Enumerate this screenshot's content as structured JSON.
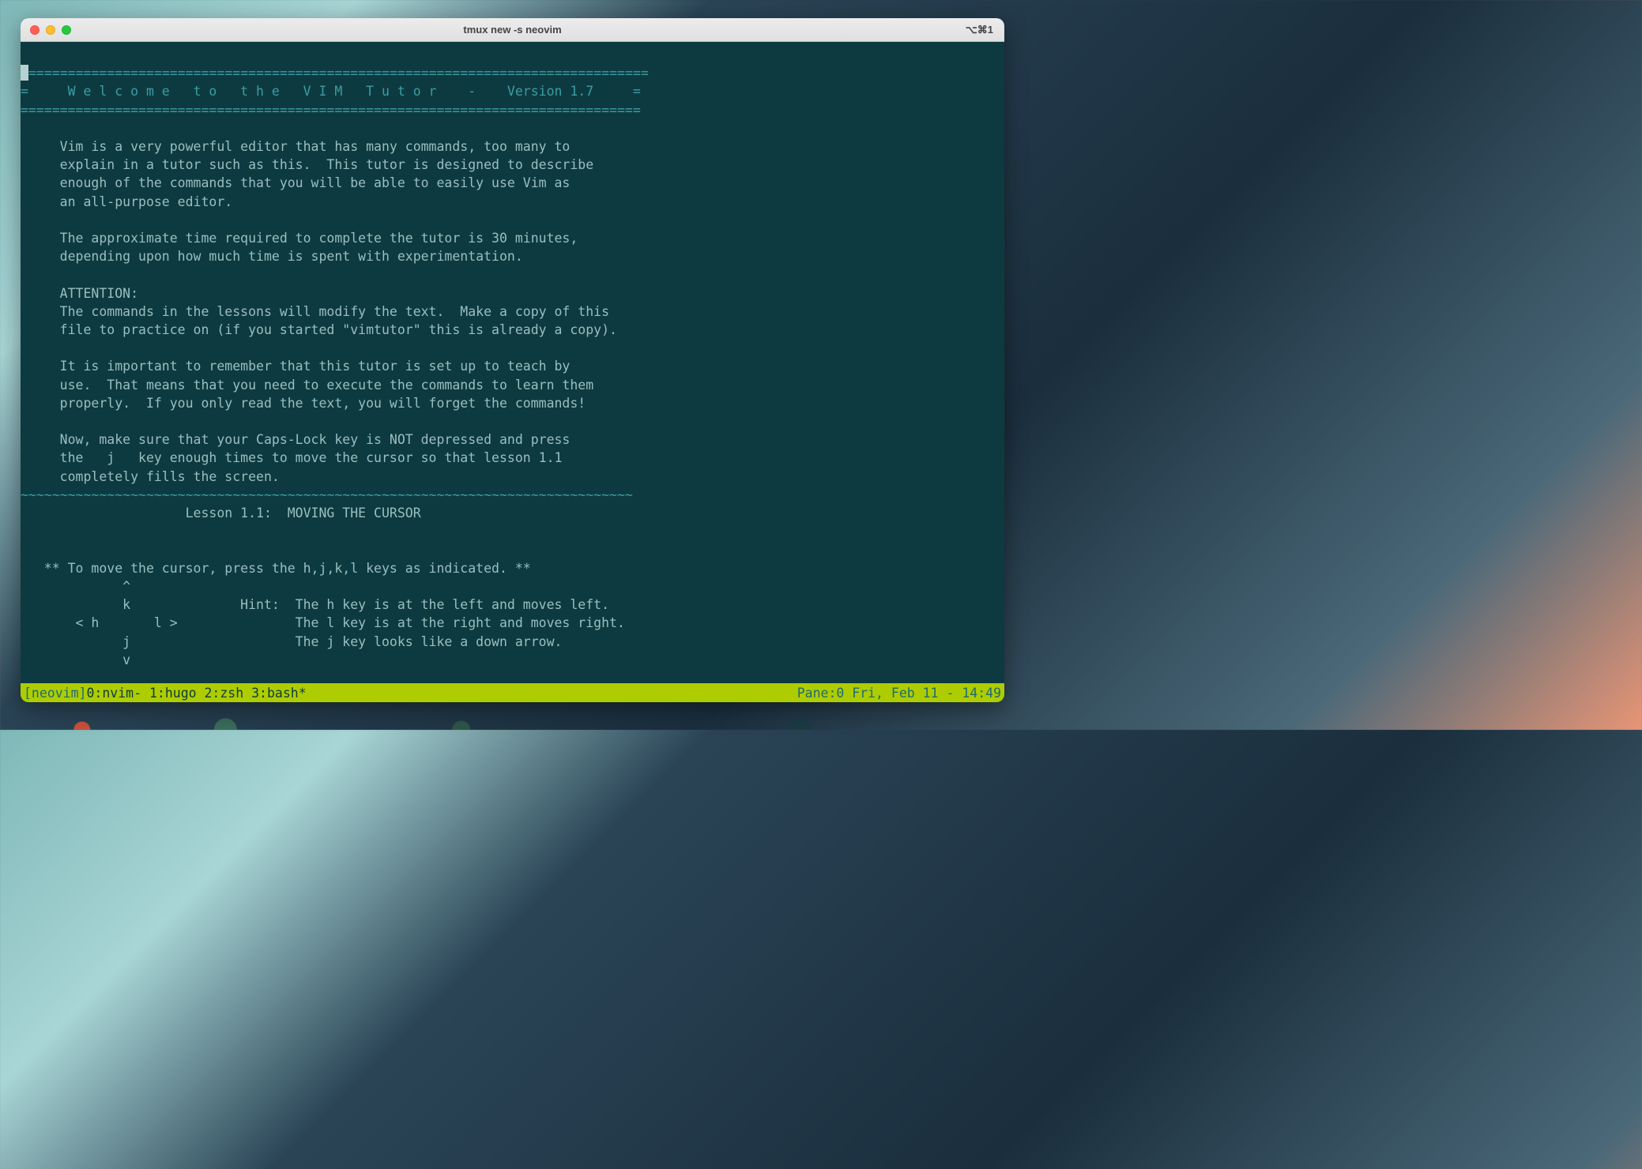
{
  "titlebar": {
    "title": "tmux new -s neovim",
    "shortcut": "⌥⌘1"
  },
  "term": {
    "eq_line": "===============================================================================",
    "header_line": "=     W e l c o m e   t o   t h e   V I M   T u t o r    -    Version 1.7     =",
    "p1_l1": "     Vim is a very powerful editor that has many commands, too many to",
    "p1_l2": "     explain in a tutor such as this.  This tutor is designed to describe",
    "p1_l3": "     enough of the commands that you will be able to easily use Vim as",
    "p1_l4": "     an all-purpose editor.",
    "p2_l1": "     The approximate time required to complete the tutor is 30 minutes,",
    "p2_l2": "     depending upon how much time is spent with experimentation.",
    "p3_l1": "     ATTENTION:",
    "p3_l2": "     The commands in the lessons will modify the text.  Make a copy of this",
    "p3_l3": "     file to practice on (if you started \"vimtutor\" this is already a copy).",
    "p4_l1": "     It is important to remember that this tutor is set up to teach by",
    "p4_l2": "     use.  That means that you need to execute the commands to learn them",
    "p4_l3": "     properly.  If you only read the text, you will forget the commands!",
    "p5_l1": "     Now, make sure that your Caps-Lock key is NOT depressed and press",
    "p5_l2": "     the   j   key enough times to move the cursor so that lesson 1.1",
    "p5_l3": "     completely fills the screen.",
    "wave_line": "~~~~~~~~~~~~~~~~~~~~~~~~~~~~~~~~~~~~~~~~~~~~~~~~~~~~~~~~~~~~~~~~~~~~~~~~~~~~~~",
    "lesson_title": "                     Lesson 1.1:  MOVING THE CURSOR",
    "inst": "   ** To move the cursor, press the h,j,k,l keys as indicated. **",
    "d1": "             ^",
    "d2": "             k              Hint:  The h key is at the left and moves left.",
    "d3": "       < h       l >               The l key is at the right and moves right.",
    "d4": "             j                     The j key looks like a down arrow.",
    "d5": "             v"
  },
  "statusbar": {
    "session": "[neovim] ",
    "windows": "0:nvim- 1:hugo  2:zsh  3:bash*",
    "right": "Pane:0 Fri, Feb 11 - 14:49"
  }
}
